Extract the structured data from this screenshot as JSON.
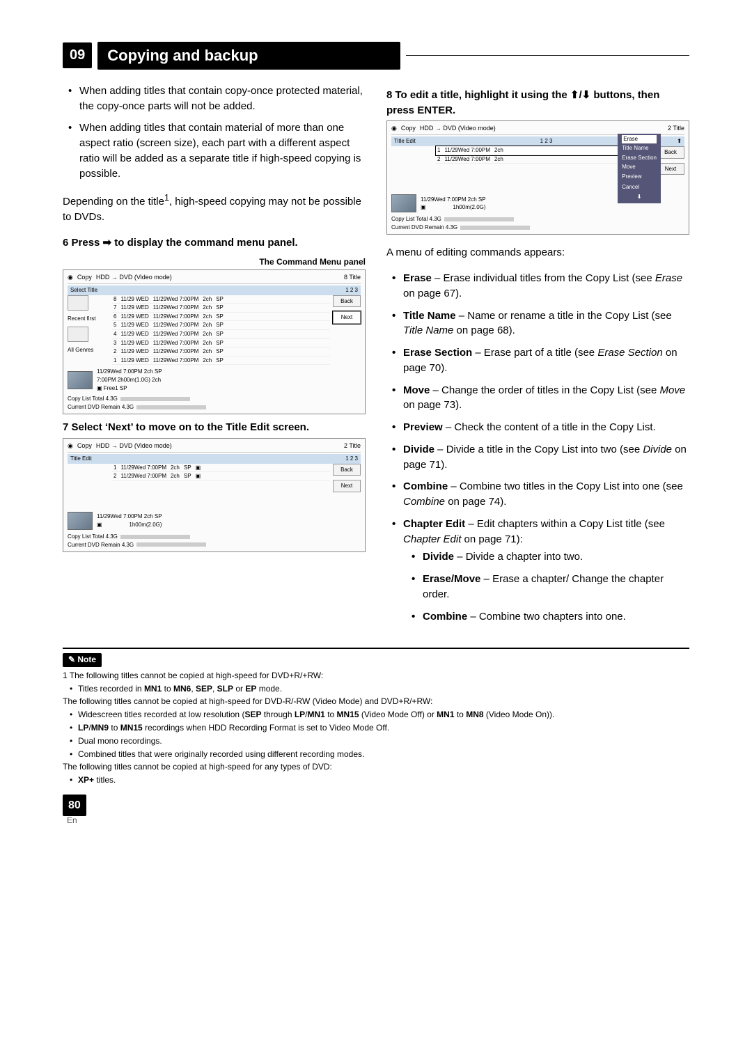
{
  "chapter": {
    "num": "09",
    "title": "Copying and backup"
  },
  "left": {
    "bullets": [
      "When adding titles that contain copy-once protected material, the copy-once parts will not be added.",
      "When adding titles that contain material of more than one aspect ratio (screen size), each part with a different aspect ratio will be added as a separate title if high-speed copying is possible."
    ],
    "depending_a": "Depending on the title",
    "depending_sup": "1",
    "depending_b": ", high-speed copying may not be possible to DVDs.",
    "step6_a": "6    Press ",
    "step6_b": " to display the command menu panel.",
    "caption1": "The Command Menu panel",
    "step7": "7    Select ‘Next’ to move on to the Title Edit screen."
  },
  "right": {
    "step8_a": "8    To edit a title, highlight it using the ",
    "step8_b": " buttons, then press ENTER.",
    "menu_intro": "A menu of editing commands appears:",
    "items": [
      {
        "term": "Erase",
        "body_a": " – Erase individual titles from the Copy List (see ",
        "it": "Erase",
        "body_b": " on page 67)."
      },
      {
        "term": "Title Name",
        "body_a": " – Name or rename a title in the Copy List (see ",
        "it": "Title Name",
        "body_b": " on page 68)."
      },
      {
        "term": "Erase Section",
        "body_a": " – Erase part of a title (see ",
        "it": "Erase Section",
        "body_b": " on page 70)."
      },
      {
        "term": "Move",
        "body_a": " – Change the order of titles in the Copy List (see ",
        "it": "Move",
        "body_b": " on page 73)."
      },
      {
        "term": "Preview",
        "body_a": " – Check the content of a title in the Copy List.",
        "it": "",
        "body_b": ""
      },
      {
        "term": "Divide",
        "body_a": " – Divide a title in the Copy List into two (see ",
        "it": "Divide",
        "body_b": " on page 71)."
      },
      {
        "term": "Combine",
        "body_a": " – Combine two titles in the Copy List into one (see ",
        "it": "Combine",
        "body_b": " on page 74)."
      },
      {
        "term": "Chapter Edit",
        "body_a": " – Edit chapters within a Copy List title (see ",
        "it": "Chapter Edit",
        "body_b": " on page 71):"
      }
    ],
    "subitems": [
      {
        "term": "Divide",
        "body": " – Divide a chapter into two."
      },
      {
        "term": "Erase/Move",
        "body": " – Erase a chapter/ Change the chapter order."
      },
      {
        "term": "Combine",
        "body": " – Combine two chapters into one."
      }
    ]
  },
  "fig1": {
    "copy": "Copy",
    "mode": "HDD → DVD (Video mode)",
    "titlecount": "8  Title",
    "tab": "Select Title",
    "left_items": [
      "Recent first",
      "All Genres"
    ],
    "rows": [
      [
        "8",
        "11/29 WED",
        "11/29Wed 7:00PM",
        "2ch",
        "SP"
      ],
      [
        "7",
        "11/29 WED",
        "11/29Wed 7:00PM",
        "2ch",
        "SP"
      ],
      [
        "6",
        "11/29 WED",
        "11/29Wed 7:00PM",
        "2ch",
        "SP"
      ],
      [
        "5",
        "11/29 WED",
        "11/29Wed 7:00PM",
        "2ch",
        "SP"
      ],
      [
        "4",
        "11/29 WED",
        "11/29Wed 7:00PM",
        "2ch",
        "SP"
      ],
      [
        "3",
        "11/29 WED",
        "11/29Wed 7:00PM",
        "2ch",
        "SP"
      ],
      [
        "2",
        "11/29 WED",
        "11/29Wed 7:00PM",
        "2ch",
        "SP"
      ],
      [
        "1",
        "11/29 WED",
        "11/29Wed 7:00PM",
        "2ch",
        "SP"
      ]
    ],
    "back": "Back",
    "next": "Next",
    "thumb_a": "11/29Wed 7:00PM   2ch   SP",
    "thumb_b": "7:00PM              2h00m(1.0G) 2ch",
    "thumb_c": "Free1        SP",
    "total": "Copy List Total",
    "total_v": "4.3G",
    "remain": "Current DVD Remain",
    "remain_v": "4.3G"
  },
  "fig2": {
    "copy": "Copy",
    "mode": "HDD → DVD (Video mode)",
    "titlecount": "2  Title",
    "tab": "Title Edit",
    "tabnums": "1  2  3",
    "rows": [
      [
        "1",
        "11/29Wed 7:00PM",
        "2ch",
        "SP"
      ],
      [
        "2",
        "11/29Wed 7:00PM",
        "2ch",
        "SP"
      ]
    ],
    "back": "Back",
    "next": "Next",
    "thumb_a": "11/29Wed 7:00PM   2ch   SP",
    "thumb_b": "1h00m(2.0G)",
    "total": "Copy List Total",
    "total_v": "4.3G",
    "remain": "Current DVD Remain",
    "remain_v": "4.3G"
  },
  "fig3": {
    "copy": "Copy",
    "mode": "HDD → DVD (Video mode)",
    "titlecount": "2  Title",
    "tab": "Title Edit",
    "tabnums": "1  2  3",
    "rows": [
      [
        "1",
        "11/29Wed 7:00PM",
        "2ch"
      ],
      [
        "2",
        "11/29Wed 7:00PM",
        "2ch"
      ]
    ],
    "menu": [
      "Erase",
      "Title Name",
      "Erase Section",
      "Move",
      "Preview",
      "",
      "Cancel"
    ],
    "back": "Back",
    "next": "Next",
    "thumb_a": "11/29Wed 7:00PM   2ch   SP",
    "thumb_b": "1h00m(2.0G)",
    "total": "Copy List Total",
    "total_v": "4.3G",
    "remain": "Current DVD Remain",
    "remain_v": "4.3G"
  },
  "note": {
    "label": "Note",
    "line1": "1 The following titles cannot be copied at high-speed for DVD+R/+RW:",
    "b1_a": "Titles recorded in ",
    "b1_b": "MN1",
    "b1_c": " to ",
    "b1_d": "MN6",
    "b1_e": ", ",
    "b1_f": "SEP",
    "b1_g": ", ",
    "b1_h": "SLP",
    "b1_i": " or ",
    "b1_j": "EP",
    "b1_k": " mode.",
    "line2": "The following titles cannot be copied at high-speed for DVD-R/-RW (Video Mode) and DVD+R/+RW:",
    "b2_a": "Widescreen titles recorded at low resolution (",
    "b2_b": "SEP",
    "b2_c": " through ",
    "b2_d": "LP",
    "b2_e": "/",
    "b2_f": "MN1",
    "b2_g": " to ",
    "b2_h": "MN15",
    "b2_i": " (Video Mode Off) or ",
    "b2_j": "MN1",
    "b2_k": " to ",
    "b2_l": "MN8",
    "b2_m": " (Video Mode On)).",
    "b3_a": "LP",
    "b3_b": "/",
    "b3_c": "MN9",
    "b3_d": " to ",
    "b3_e": "MN15",
    "b3_f": " recordings when HDD Recording Format is set to Video Mode Off.",
    "b4": "Dual mono recordings.",
    "b5": "Combined titles that were originally recorded using different recording modes.",
    "line3": "The following titles cannot be copied at high-speed for any types of DVD:",
    "b6_a": "XP+",
    "b6_b": " titles."
  },
  "pageno": "80",
  "lang": "En"
}
